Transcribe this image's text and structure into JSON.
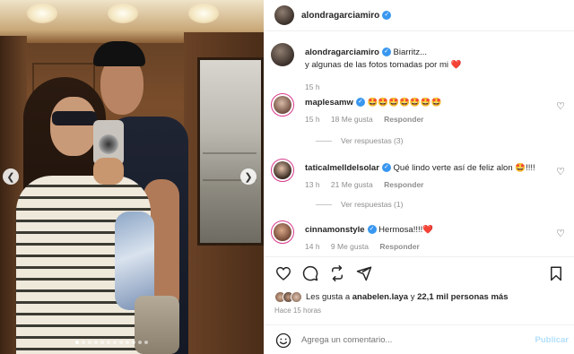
{
  "post": {
    "author": "alondragarciamiro",
    "caption_line1": "Biarritz...",
    "caption_line2": "y algunas de las fotos tomadas por mi",
    "caption_heart": "❤️",
    "caption_time": "15 h"
  },
  "comments": [
    {
      "username": "maplesamw",
      "text": "🤩🤩🤩🤩🤩🤩🤩",
      "time": "15 h",
      "likes": "18 Me gusta",
      "reply": "Responder",
      "view_replies": "Ver respuestas (3)"
    },
    {
      "username": "taticalmelldelsolar",
      "text": "Qué lindo verte así de feliz alon 🤩!!!!",
      "time": "13 h",
      "likes": "21 Me gusta",
      "reply": "Responder",
      "view_replies": "Ver respuestas (1)"
    },
    {
      "username": "cinnamonstyle",
      "text": "Hermosa!!!!❤️",
      "time": "14 h",
      "likes": "9 Me gusta",
      "reply": "Responder"
    }
  ],
  "likes_summary": {
    "prefix": "Les gusta a ",
    "user": "anabelen.laya",
    "middle": " y ",
    "count": "22,1 mil personas más"
  },
  "posted_ago": "Hace 15 horas",
  "composer": {
    "placeholder": "Agrega un comentario...",
    "post_label": "Publicar"
  },
  "carousel": {
    "total_slides": 12,
    "active_slide": 1
  },
  "icons": {
    "like": "heart-icon",
    "comment": "comment-icon",
    "share": "share-icon",
    "send": "send-icon",
    "save": "bookmark-icon",
    "emoji": "emoji-icon"
  },
  "colors": {
    "verified": "#3897f0",
    "link_blue": "#b2dffc",
    "muted": "#8e8e8e"
  }
}
